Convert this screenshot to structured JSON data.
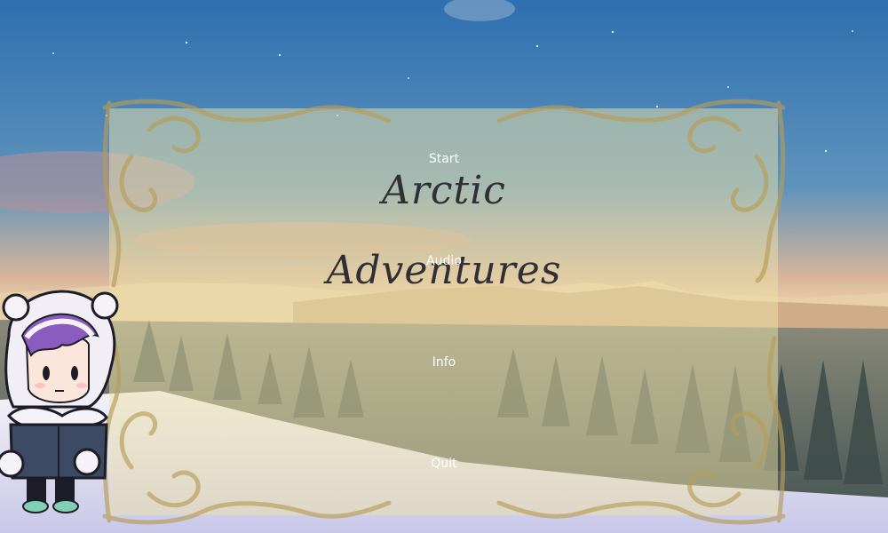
{
  "game": {
    "title": "Arctic Adventures"
  },
  "menu": {
    "start": "Start",
    "audio": "Audio",
    "info": "Info",
    "quit": "Quit"
  },
  "colors": {
    "sky_top": "#2e6fb0",
    "sky_mid": "#5f93bb",
    "horizon": "#e8c9a0",
    "panel": "#eee2a8",
    "ornament": "#c9b06a",
    "title_text": "#2f2f35",
    "menu_text": "#ffffff"
  },
  "icons": {
    "background": "snowy-mountain-forest-scene",
    "frame": "ornate-scroll-frame",
    "character": "chibi-character-portrait"
  }
}
